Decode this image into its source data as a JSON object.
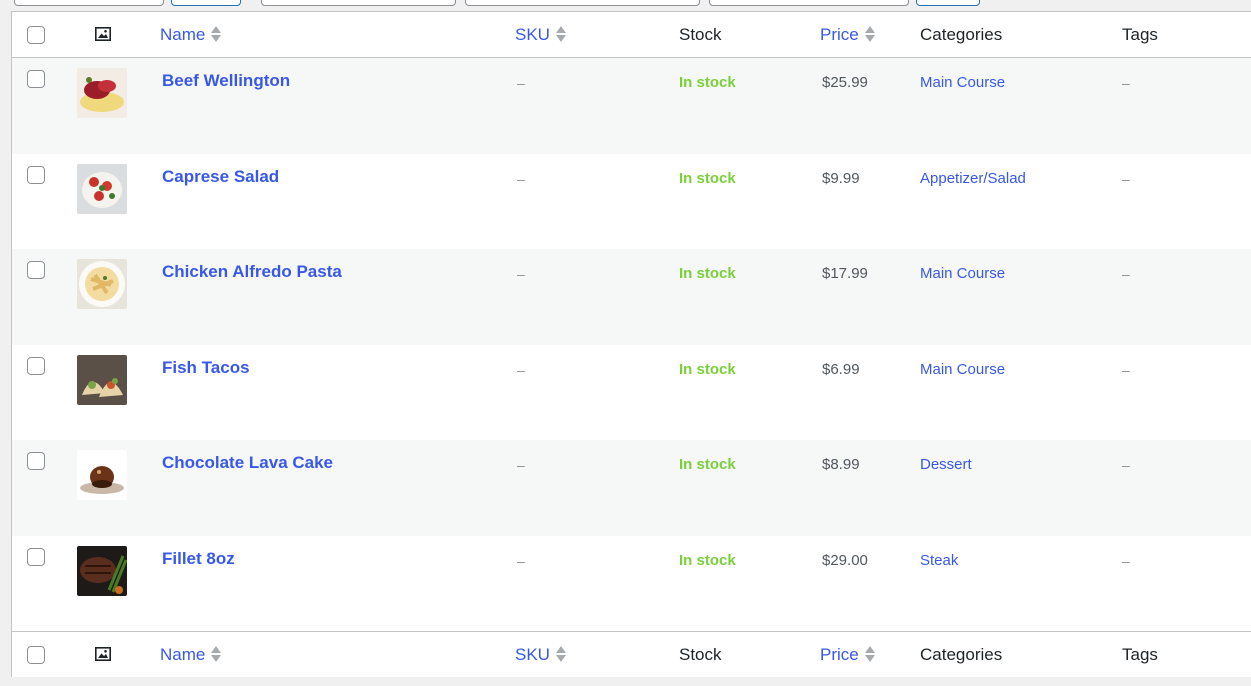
{
  "columns": {
    "name": "Name",
    "sku": "SKU",
    "stock": "Stock",
    "price": "Price",
    "categories": "Categories",
    "tags": "Tags",
    "image_icon": "image-icon"
  },
  "products": [
    {
      "name": "Beef Wellington",
      "sku": "–",
      "stock": "In stock",
      "price": "$25.99",
      "category": "Main Course",
      "tags": "–"
    },
    {
      "name": "Caprese Salad",
      "sku": "–",
      "stock": "In stock",
      "price": "$9.99",
      "category": "Appetizer/Salad",
      "tags": "–"
    },
    {
      "name": "Chicken Alfredo Pasta",
      "sku": "–",
      "stock": "In stock",
      "price": "$17.99",
      "category": "Main Course",
      "tags": "–"
    },
    {
      "name": "Fish Tacos",
      "sku": "–",
      "stock": "In stock",
      "price": "$6.99",
      "category": "Main Course",
      "tags": "–"
    },
    {
      "name": "Chocolate Lava Cake",
      "sku": "–",
      "stock": "In stock",
      "price": "$8.99",
      "category": "Dessert",
      "tags": "–"
    },
    {
      "name": "Fillet 8oz",
      "sku": "–",
      "stock": "In stock",
      "price": "$29.00",
      "category": "Steak",
      "tags": "–"
    }
  ],
  "colors": {
    "link": "#3858e9",
    "in_stock": "#7ad03a",
    "row_alt": "#f6f7f7",
    "border": "#c3c4c7"
  }
}
